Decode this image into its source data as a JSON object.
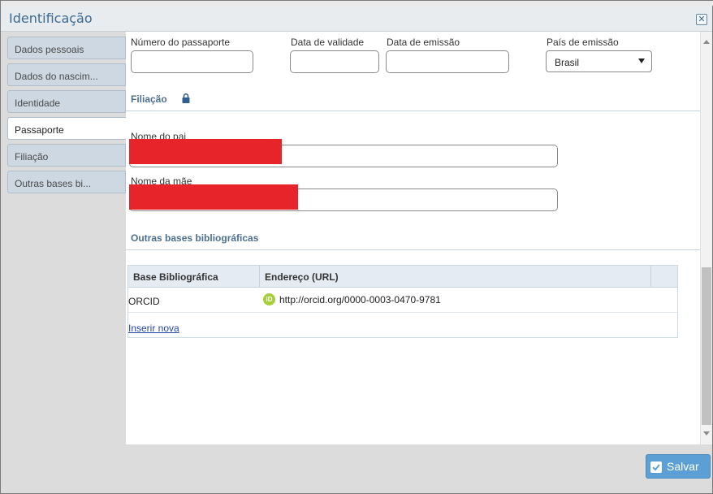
{
  "window": {
    "title": "Identificação"
  },
  "sidebar": {
    "items": [
      {
        "label": "Dados pessoais",
        "active": false
      },
      {
        "label": "Dados do nascim...",
        "active": false
      },
      {
        "label": "Identidade",
        "active": false
      },
      {
        "label": "Passaporte",
        "active": true
      },
      {
        "label": "Filiação",
        "active": false
      },
      {
        "label": "Outras bases bi...",
        "active": false
      }
    ]
  },
  "passport": {
    "number_label": "Número do passaporte",
    "validity_label": "Data de validade",
    "issue_date_label": "Data de emissão",
    "country_label": "País de emissão",
    "country_value": "Brasil"
  },
  "filiacao": {
    "section_title": "Filiação",
    "father_label": "Nome do pai",
    "mother_label": "Nome da mãe"
  },
  "bibliographic": {
    "section_title": "Outras bases bibliográficas",
    "columns": [
      "Base Bibliográfica",
      "Endereço (URL)"
    ],
    "rows": [
      {
        "base": "ORCID",
        "url": "http://orcid.org/0000-0003-0470-9781"
      }
    ],
    "orcid_icon_text": "iD",
    "insert_link": "Inserir nova"
  },
  "footer": {
    "save_label": "Salvar"
  },
  "colors": {
    "accent": "#5b9fd4",
    "redaction": "#e8242b",
    "orcid": "#a6ce39"
  }
}
